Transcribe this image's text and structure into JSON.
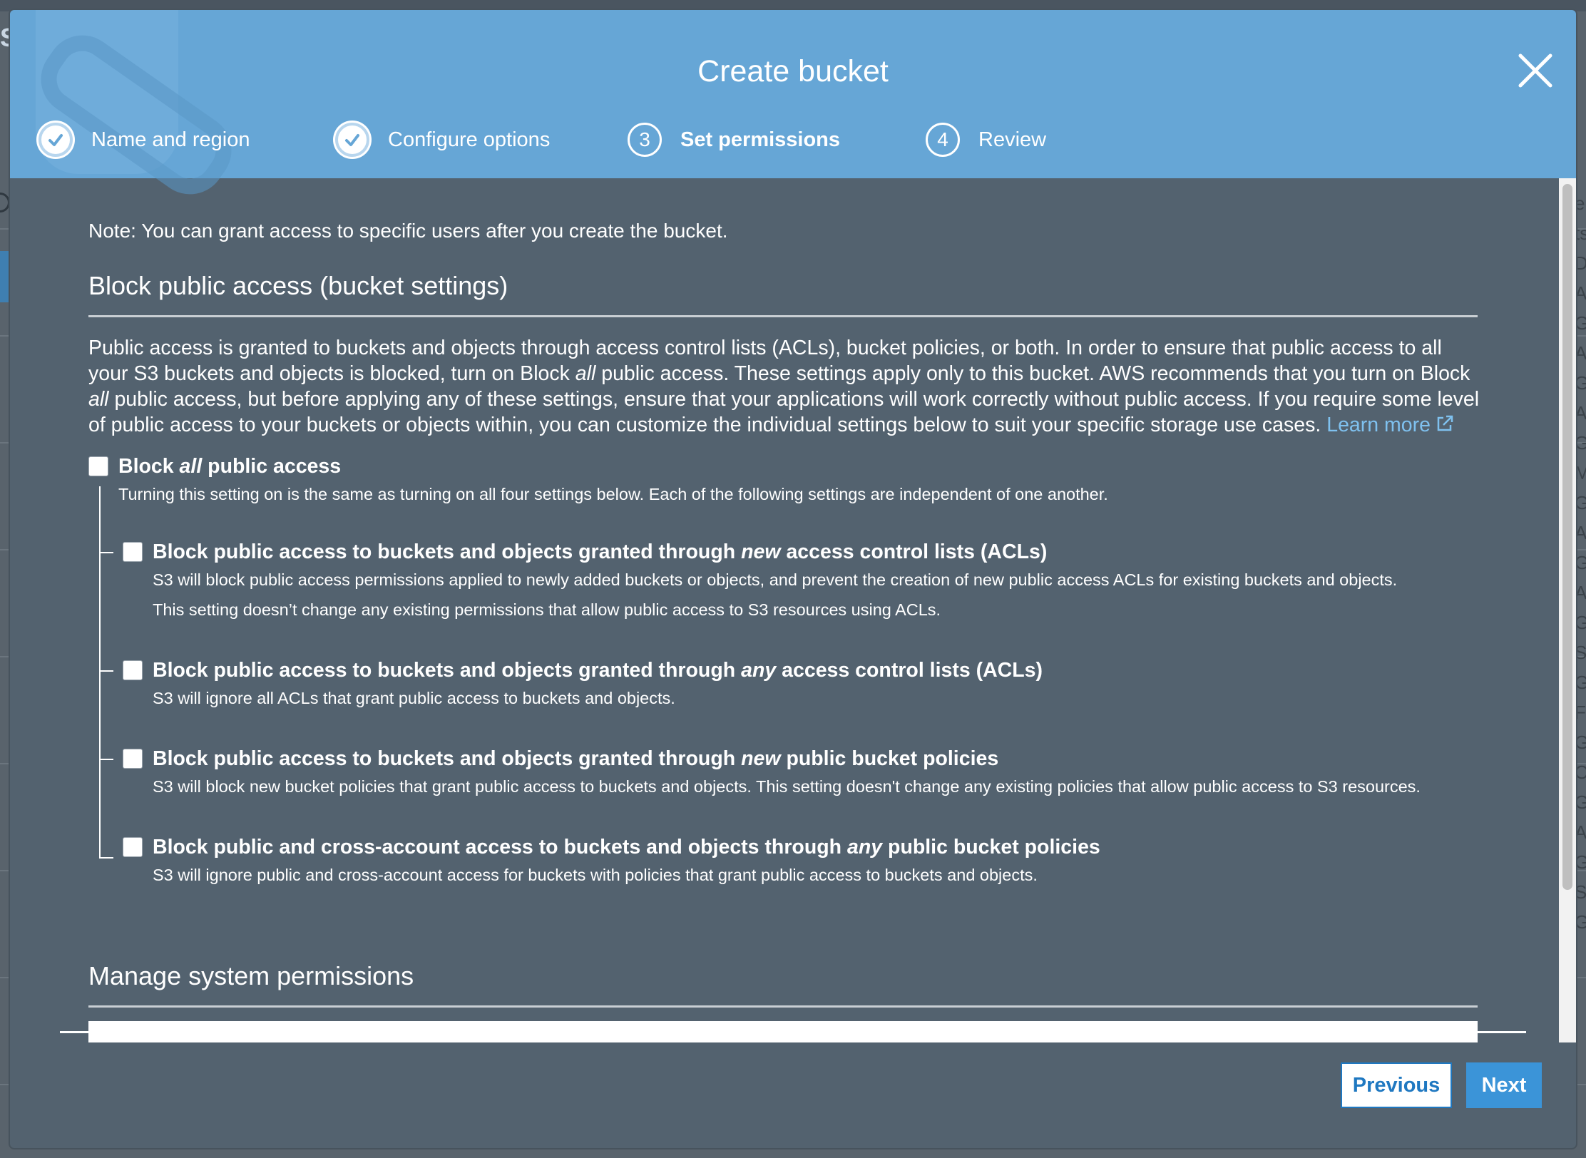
{
  "background_page": {
    "left_letter": "S",
    "right_column_letters": [
      "e",
      "ts",
      "D",
      "A",
      "G",
      "A",
      "G",
      "A",
      "G",
      "M",
      "G",
      "A",
      "G",
      "A",
      "G",
      "S",
      "G",
      "F",
      "G",
      "O",
      "G",
      "A",
      "G",
      "S",
      "G"
    ]
  },
  "modal": {
    "title": "Create bucket",
    "steps": [
      {
        "label": "Name and region",
        "state": "done",
        "number": ""
      },
      {
        "label": "Configure options",
        "state": "done",
        "number": ""
      },
      {
        "label": "Set permissions",
        "state": "active",
        "number": "3"
      },
      {
        "label": "Review",
        "state": "pending",
        "number": "4"
      }
    ]
  },
  "content": {
    "note": "Note: You can grant access to specific users after you create the bucket.",
    "block_section": {
      "heading": "Block public access (bucket settings)",
      "description_lines": [
        "Public access is granted to buckets and objects through access control lists (ACLs), bucket policies, or both. In order to ensure that public access to all",
        "your S3 buckets and objects is blocked, turn on Block",
        "all",
        "public access. These settings apply only to this bucket. AWS recommends that you turn on Block",
        "public access, but before applying any of these settings, ensure that your applications will work correctly without public access. If you require some level",
        "of public access to your buckets or objects within, you can customize the individual settings below to suit your specific storage use cases."
      ],
      "learn_more": "Learn more",
      "block_all": {
        "title_prefix": "Block",
        "title_em": "all",
        "title_suffix": "public access",
        "subtitle": "Turning this setting on is the same as turning on all four settings below. Each of the following settings are independent of one another.",
        "checked": false
      },
      "options": [
        {
          "title_prefix": "Block public access to buckets and objects granted through",
          "title_em": "new",
          "title_suffix": "access control lists (ACLs)",
          "lines": [
            "S3 will block public access permissions applied to newly added buckets or objects, and prevent the creation of new public access ACLs for existing buckets and objects.",
            "This setting doesn’t change any existing permissions that allow public access to S3 resources using ACLs."
          ],
          "checked": false
        },
        {
          "title_prefix": "Block public access to buckets and objects granted through",
          "title_em": "any",
          "title_suffix": "access control lists (ACLs)",
          "lines": [
            "S3 will ignore all ACLs that grant public access to buckets and objects."
          ],
          "checked": false
        },
        {
          "title_prefix": "Block public access to buckets and objects granted through",
          "title_em": "new",
          "title_suffix": "public bucket policies",
          "lines": [
            "S3 will block new bucket policies that grant public access to buckets and objects. This setting doesn't change any existing policies that allow public access to S3 resources."
          ],
          "checked": false
        },
        {
          "title_prefix": "Block public and cross-account access to buckets and objects through",
          "title_em": "any",
          "title_suffix": "public bucket policies",
          "lines": [
            "S3 will ignore public and cross-account access for buckets with policies that grant public access to buckets and objects."
          ],
          "checked": false
        }
      ]
    },
    "system_section": {
      "heading": "Manage system permissions"
    }
  },
  "footer": {
    "previous_label": "Previous",
    "next_label": "Next"
  },
  "colors": {
    "header_blue": "#66a6d6",
    "modal_body": "#53626f",
    "link": "#7fc1ef",
    "primary_button": "#3b94d8"
  }
}
